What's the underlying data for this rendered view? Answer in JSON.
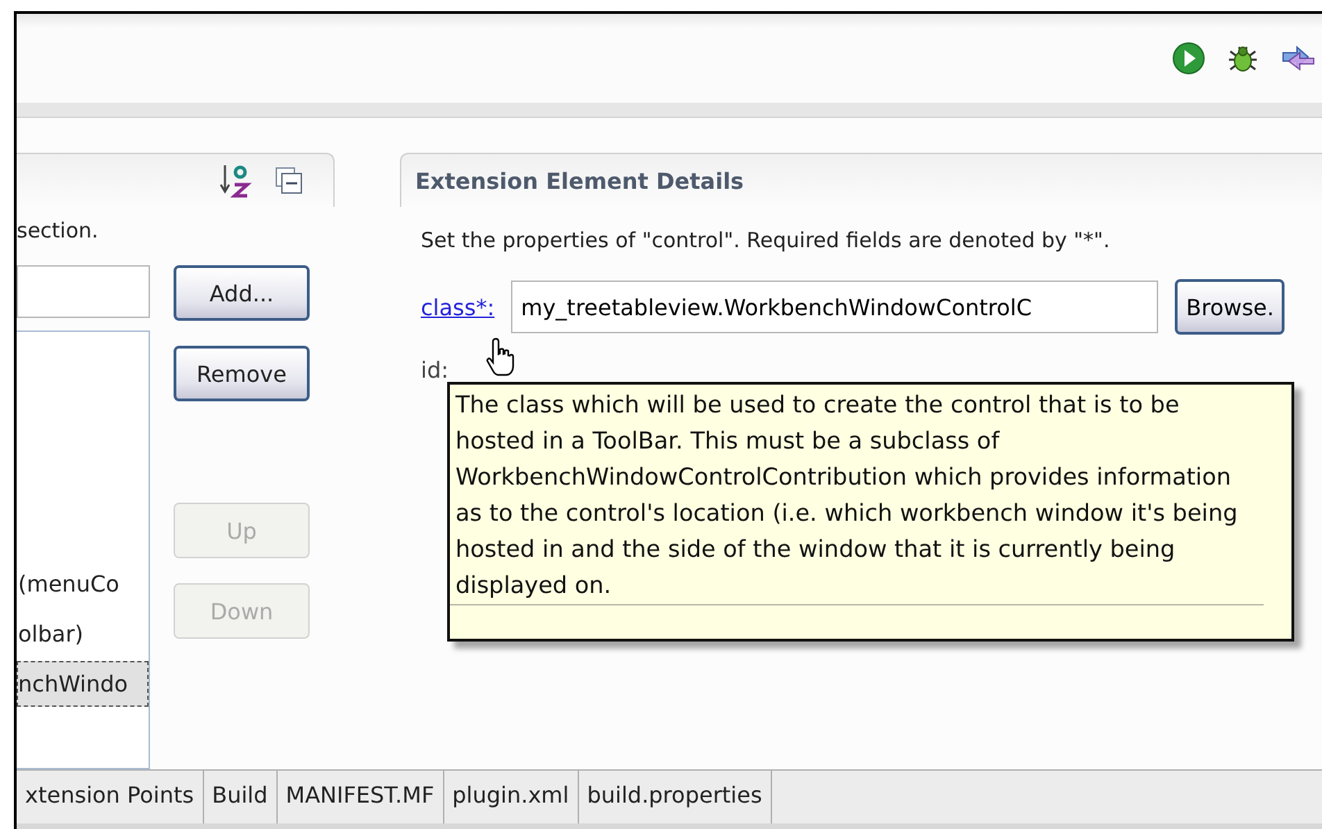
{
  "master_section": {
    "description": "section.",
    "items": [
      {
        "label": "(menuCo",
        "selected": false
      },
      {
        "label": "olbar)",
        "selected": false
      },
      {
        "label": "nchWindo",
        "selected": true
      }
    ],
    "buttons": [
      {
        "label": "Add...",
        "disabled": false
      },
      {
        "label": "Remove",
        "disabled": false
      },
      {
        "label": "Up",
        "disabled": true
      },
      {
        "label": "Down",
        "disabled": true
      }
    ]
  },
  "details_section": {
    "title": "Extension Element Details",
    "description": "Set the properties of \"control\". Required fields are denoted by \"*\".",
    "fields": [
      {
        "kind": "link",
        "label": "class*:",
        "value": "my_treetableview.WorkbenchWindowControlC",
        "button": "Browse."
      },
      {
        "kind": "plain",
        "label": "id:"
      }
    ]
  },
  "tooltip": {
    "text": "The class which will be used to create the control that is to be hosted in a ToolBar. This must be a subclass of WorkbenchWindowControlContribution which provides information as to the control's location (i.e. which workbench window it's being hosted in and the side of the window that it is currently being displayed on."
  },
  "tabs": [
    {
      "label": "xtension Points",
      "selected": false
    },
    {
      "label": "Build",
      "selected": false
    },
    {
      "label": "MANIFEST.MF",
      "selected": false
    },
    {
      "label": "plugin.xml",
      "selected": false
    },
    {
      "label": "build.properties",
      "selected": false
    }
  ]
}
